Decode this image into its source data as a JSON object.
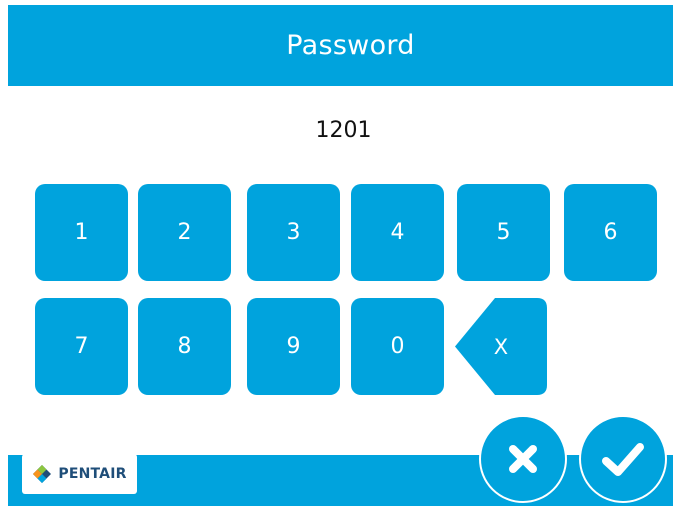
{
  "header": {
    "title": "Password"
  },
  "entry": {
    "value": "1201"
  },
  "keypad": {
    "keys": [
      "1",
      "2",
      "3",
      "4",
      "5",
      "6",
      "7",
      "8",
      "9",
      "0"
    ],
    "backspace_label": "X"
  },
  "footer": {
    "logo_text": "PENTAIR"
  },
  "actions": {
    "cancel": "close-icon",
    "confirm": "checkmark-icon"
  },
  "colors": {
    "primary": "#00a3dd",
    "background": "#ffffff",
    "logo_text": "#1f4e79",
    "logo_accent": "#8cc63f"
  }
}
